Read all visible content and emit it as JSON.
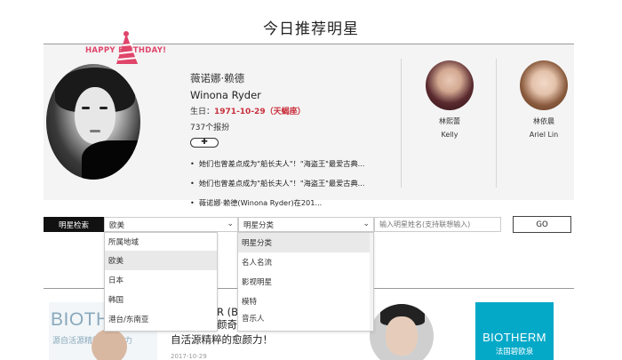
{
  "page": {
    "title": "今日推荐明星"
  },
  "birthday_banner": "HAPPY     BIRTHDAY!",
  "featured": {
    "cn_name": "薇诺娜·赖德",
    "en_name": "Winona Ryder",
    "birth_label": "生日：",
    "birth_date": "1971-10-29",
    "sign": "（天蝎座）",
    "reports": "737个报扮",
    "plus_label": "✚",
    "news": [
      "她们也曾差点成为\"船长夫人\"！\"海盗王\"最爱古典...",
      "她们也曾差点成为\"船长夫人\"！\"海盗王\"最爱古典...",
      "薇诺娜·赖德(Winona Ryder)在201..."
    ]
  },
  "side_stars": [
    {
      "cn": "林熙蕾",
      "en": "Kelly"
    },
    {
      "cn": "林依晨",
      "en": "Ariel Lin"
    }
  ],
  "search": {
    "label": "明星检索",
    "region_value": "欧美",
    "category_value": "明星分类",
    "placeholder": "输入明星姓名(支持联想输入)",
    "go_label": "GO"
  },
  "region_options": [
    "所属地域",
    "欧美",
    "日本",
    "韩国",
    "港台/东南亚"
  ],
  "category_options": [
    "明星分类",
    "名人名流",
    "影视明星",
    "模特",
    "音乐人"
  ],
  "bottom": {
    "brand_a": "BIOTHE",
    "brand_a_sub": "源自活源精粹的愈颜力",
    "overlay_text": "R (Bic",
    "overlay_text2": "颜奇",
    "article_title": "自活源精粹的愈颜力！",
    "article_date": "2017-10-29",
    "brand_b": "BIOTHERM",
    "brand_b_sub": "法国碧欧泉"
  },
  "colors": {
    "accent_red": "#c9303c",
    "birthday_pink": "#e0456a",
    "label_bg": "#111111",
    "brand_teal": "#05a9c8"
  }
}
